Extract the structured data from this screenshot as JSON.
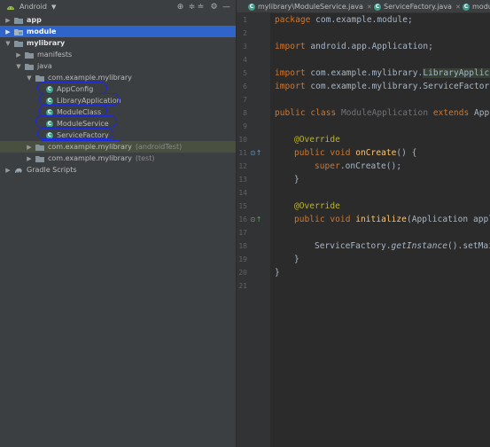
{
  "panel": {
    "view_label": "Android",
    "tools": [
      "⊕",
      "≑",
      "≐",
      "⚙",
      "—"
    ]
  },
  "tree": [
    {
      "label": "app",
      "bold": true,
      "kind": "folder",
      "expanded": false
    },
    {
      "label": "module",
      "bold": true,
      "kind": "folder",
      "expanded": false,
      "selected": true
    },
    {
      "label": "mylibrary",
      "bold": true,
      "kind": "folder",
      "expanded": true
    },
    {
      "label": "manifests",
      "kind": "folder",
      "expanded": false
    },
    {
      "label": "java",
      "kind": "folder",
      "expanded": true
    },
    {
      "label": "com.example.mylibrary",
      "kind": "package",
      "expanded": true
    },
    {
      "label": "AppConfig",
      "kind": "class"
    },
    {
      "label": "LibraryApplication",
      "kind": "class"
    },
    {
      "label": "ModuleClass",
      "kind": "class"
    },
    {
      "label": "ModuleService",
      "kind": "class"
    },
    {
      "label": "ServiceFactory",
      "kind": "class"
    },
    {
      "label": "com.example.mylibrary",
      "suffix": "(androidTest)",
      "kind": "package",
      "expanded": false,
      "test": true
    },
    {
      "label": "com.example.mylibrary",
      "suffix": "(test)",
      "kind": "package",
      "expanded": false
    },
    {
      "label": "Gradle Scripts",
      "kind": "gradle",
      "expanded": false
    }
  ],
  "tabs": [
    {
      "label": "mylibrary\\ModuleService.java"
    },
    {
      "label": "ServiceFactory.java"
    },
    {
      "label": "modu"
    }
  ],
  "colors": {
    "selection": "#2f65ca",
    "keyword": "#cc7832",
    "annotation": "#bbb529",
    "method": "#ffc66d",
    "annotation_ink": "#1d2ad8"
  },
  "code": {
    "line_numbers": [
      "1",
      "2",
      "3",
      "4",
      "5",
      "6",
      "7",
      "8",
      "9",
      "10",
      "11",
      "12",
      "13",
      "14",
      "15",
      "16",
      "17",
      "18",
      "19",
      "20",
      "21"
    ],
    "l1_kw": "package",
    "l1_rest": " com.example.module;",
    "l3_kw": "import",
    "l3_rest": " android.app.Application;",
    "l5_kw": "import",
    "l5_rest": " com.example.mylibrary.",
    "l5_cls": "LibraryApplica",
    "l6_kw": "import",
    "l6_rest": " com.example.mylibrary.ServiceFactory",
    "l8_kw": "public class",
    "l8_name": " ModuleApplication ",
    "l8_ext": "extends",
    "l8_rest": " Appl",
    "l10_ann": "@Override",
    "l11_kw": "public void",
    "l11_fn": " onCreate",
    "l11_rest": "() {",
    "l12_kw": "super",
    "l12_rest": ".onCreate();",
    "l13": "}",
    "l15_ann": "@Override",
    "l16_kw": "public void",
    "l16_fn": " initialize",
    "l16_rest": "(Application appl",
    "l18_a": "ServiceFactory.",
    "l18_it": "getInstance",
    "l18_b": "().setMai",
    "l19": "}",
    "l20": "}"
  }
}
